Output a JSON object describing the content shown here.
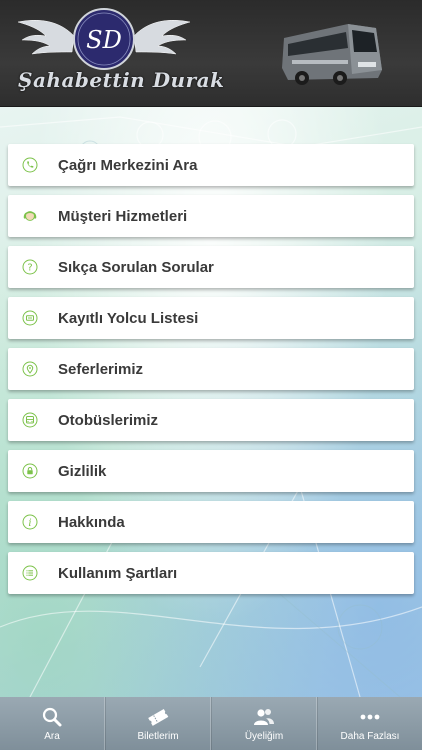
{
  "header": {
    "brand_monogram": "SD",
    "brand_name": "Şahabettin Durak"
  },
  "menu": {
    "items": [
      {
        "label": "Çağrı Merkezini Ara",
        "icon": "phone-icon"
      },
      {
        "label": "Müşteri Hizmetleri",
        "icon": "agent-icon"
      },
      {
        "label": "Sıkça Sorulan Sorular",
        "icon": "question-icon"
      },
      {
        "label": "Kayıtlı Yolcu Listesi",
        "icon": "id-card-icon"
      },
      {
        "label": "Seferlerimiz",
        "icon": "map-pin-icon"
      },
      {
        "label": "Otobüslerimiz",
        "icon": "bus-icon"
      },
      {
        "label": "Gizlilik",
        "icon": "lock-icon"
      },
      {
        "label": "Hakkında",
        "icon": "info-icon"
      },
      {
        "label": "Kullanım Şartları",
        "icon": "list-icon"
      }
    ]
  },
  "tabbar": {
    "tabs": [
      {
        "label": "Ara",
        "icon": "search-icon"
      },
      {
        "label": "Biletlerim",
        "icon": "ticket-icon"
      },
      {
        "label": "Üyeliğim",
        "icon": "users-icon"
      },
      {
        "label": "Daha Fazlası",
        "icon": "more-icon"
      }
    ]
  },
  "colors": {
    "header_bg": "#2e2e2e",
    "icon_accent": "#7cc24a",
    "item_text": "#3a3a3a",
    "tabbar_bg": "#8a9aa5"
  }
}
